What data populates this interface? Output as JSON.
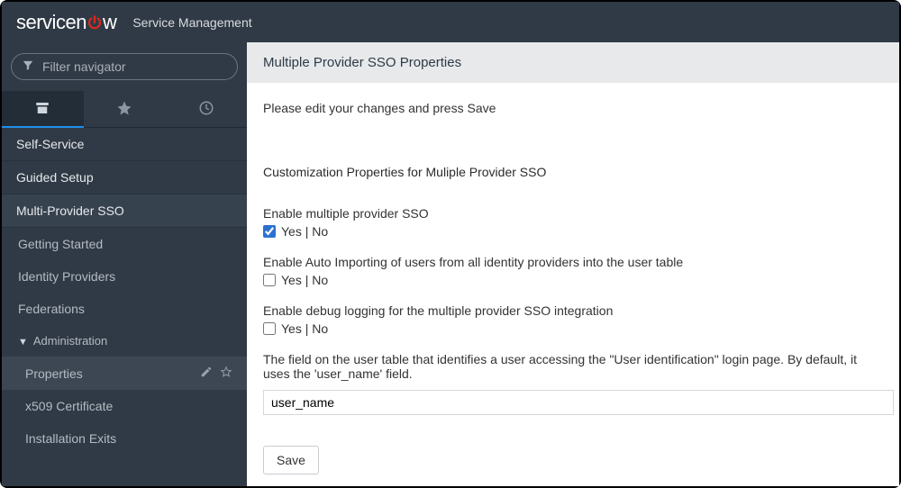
{
  "header": {
    "logo_service": "service",
    "logo_n": "n",
    "logo_w": "w",
    "subtitle": "Service Management"
  },
  "sidebar": {
    "filter_placeholder": "Filter navigator",
    "items": {
      "self_service": "Self-Service",
      "guided_setup": "Guided Setup",
      "multi_sso": "Multi-Provider SSO",
      "getting_started": "Getting Started",
      "identity_providers": "Identity Providers",
      "federations": "Federations",
      "administration": "Administration",
      "properties": "Properties",
      "x509": "x509 Certificate",
      "installation_exits": "Installation Exits"
    }
  },
  "page": {
    "title": "Multiple Provider SSO Properties",
    "instruct": "Please edit your changes and press Save",
    "section_title": "Customization Properties for Muliple Provider SSO",
    "prop1_label": "Enable multiple provider SSO",
    "prop2_label": "Enable Auto Importing of users from all identity providers into the user table",
    "prop3_label": "Enable debug logging for the multiple provider SSO integration",
    "prop4_label": "The field on the user table that identifies a user accessing the \"User identification\" login page. By default, it uses the 'user_name' field.",
    "yesno": "Yes | No",
    "prop4_value": "user_name",
    "save_label": "Save"
  }
}
